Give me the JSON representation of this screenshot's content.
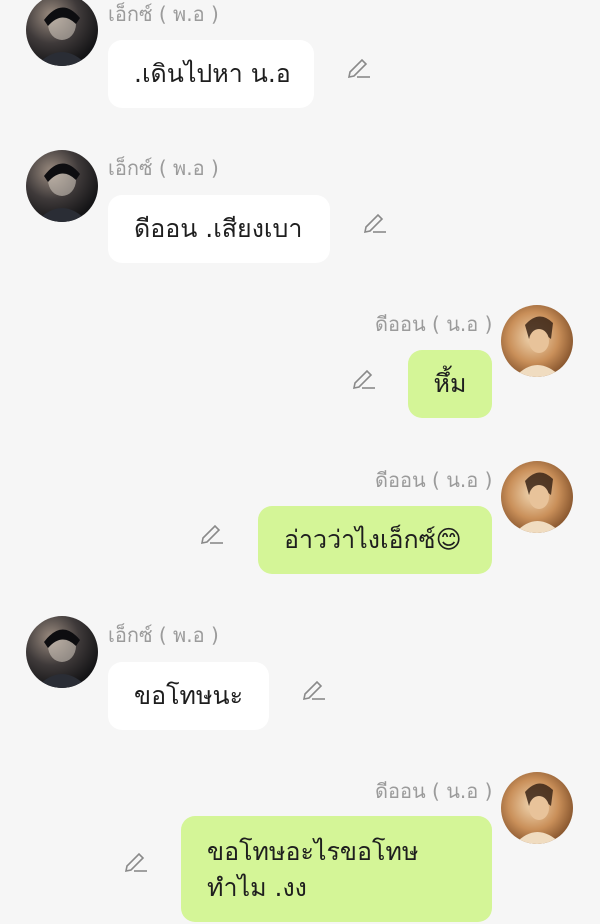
{
  "messages": [
    {
      "side": "in",
      "sender": "เอ็กซ์ ( พ.อ )",
      "text": ".เดินไปหา น.อ",
      "avatar": "avatar-dark"
    },
    {
      "side": "in",
      "sender": "เอ็กซ์ ( พ.อ )",
      "text": "ดีออน .เสียงเบา",
      "avatar": "avatar-dark"
    },
    {
      "side": "out",
      "sender": "ดีออน ( น.อ )",
      "text": "หึ้ม",
      "avatar": "avatar-warm"
    },
    {
      "side": "out",
      "sender": "ดีออน ( น.อ )",
      "text": "อ่าวว่าไงเอ็กซ์😊",
      "avatar": "avatar-warm"
    },
    {
      "side": "in",
      "sender": "เอ็กซ์ ( พ.อ )",
      "text": "ขอโทษนะ",
      "avatar": "avatar-dark"
    },
    {
      "side": "out",
      "sender": "ดีออน ( น.อ )",
      "text": "ขอโทษอะไรขอโทษ ทำไม .งง",
      "avatar": "avatar-warm"
    }
  ],
  "colors": {
    "incoming_bubble": "#ffffff",
    "outgoing_bubble": "#d4f597",
    "background": "#f6f6f6",
    "sender_name": "#9b9b9b"
  },
  "icons": {
    "edit": "pencil-icon"
  }
}
